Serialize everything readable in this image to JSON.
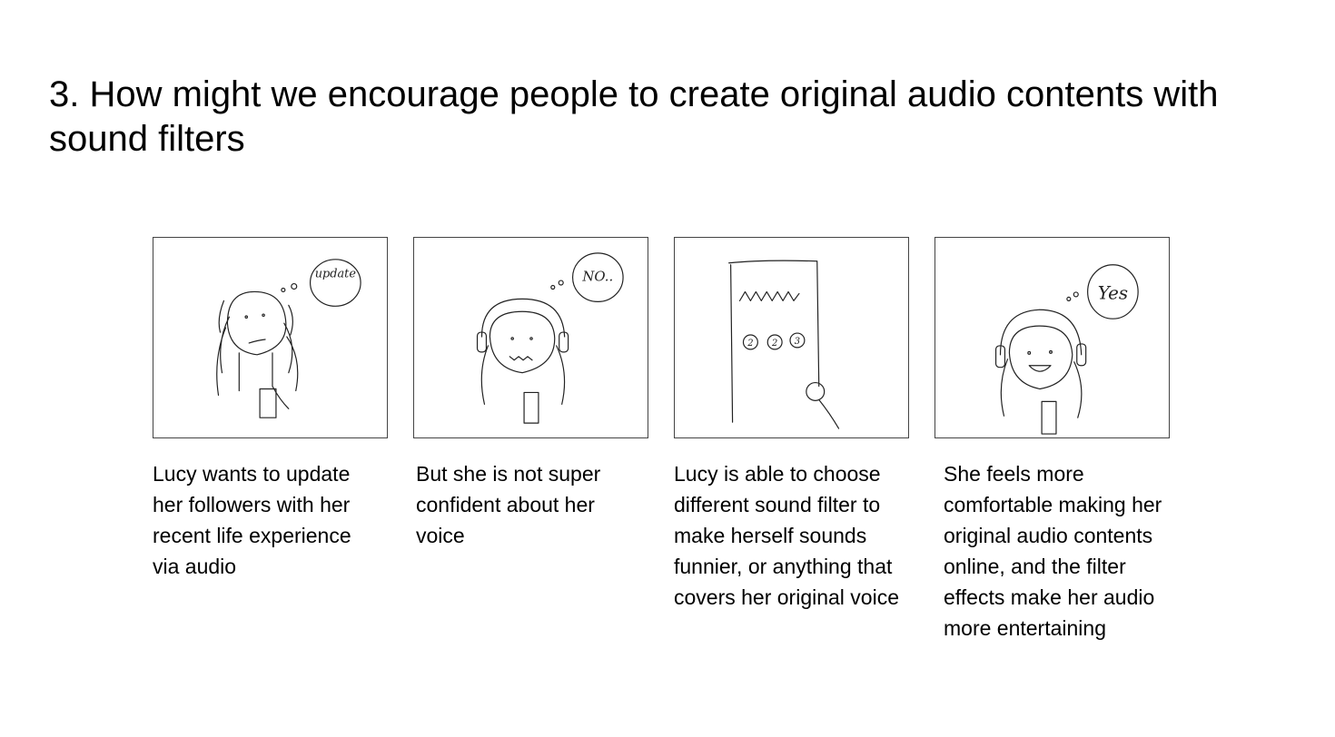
{
  "slide": {
    "title": "3. How might we encourage people to create original audio contents with sound filters"
  },
  "storyboard": [
    {
      "bubble_text": "update",
      "caption": "Lucy wants to update her followers with her recent life experience via audio"
    },
    {
      "bubble_text": "NO..",
      "caption": "But she is not super confident about her voice"
    },
    {
      "filter_options": [
        "2",
        "2",
        "3"
      ],
      "caption": "Lucy is able to choose different sound filter to make herself sounds funnier, or anything that covers her original voice"
    },
    {
      "bubble_text": "Yes",
      "caption": "She feels more comfortable making her original audio contents online, and the filter effects make her audio more entertaining"
    }
  ]
}
